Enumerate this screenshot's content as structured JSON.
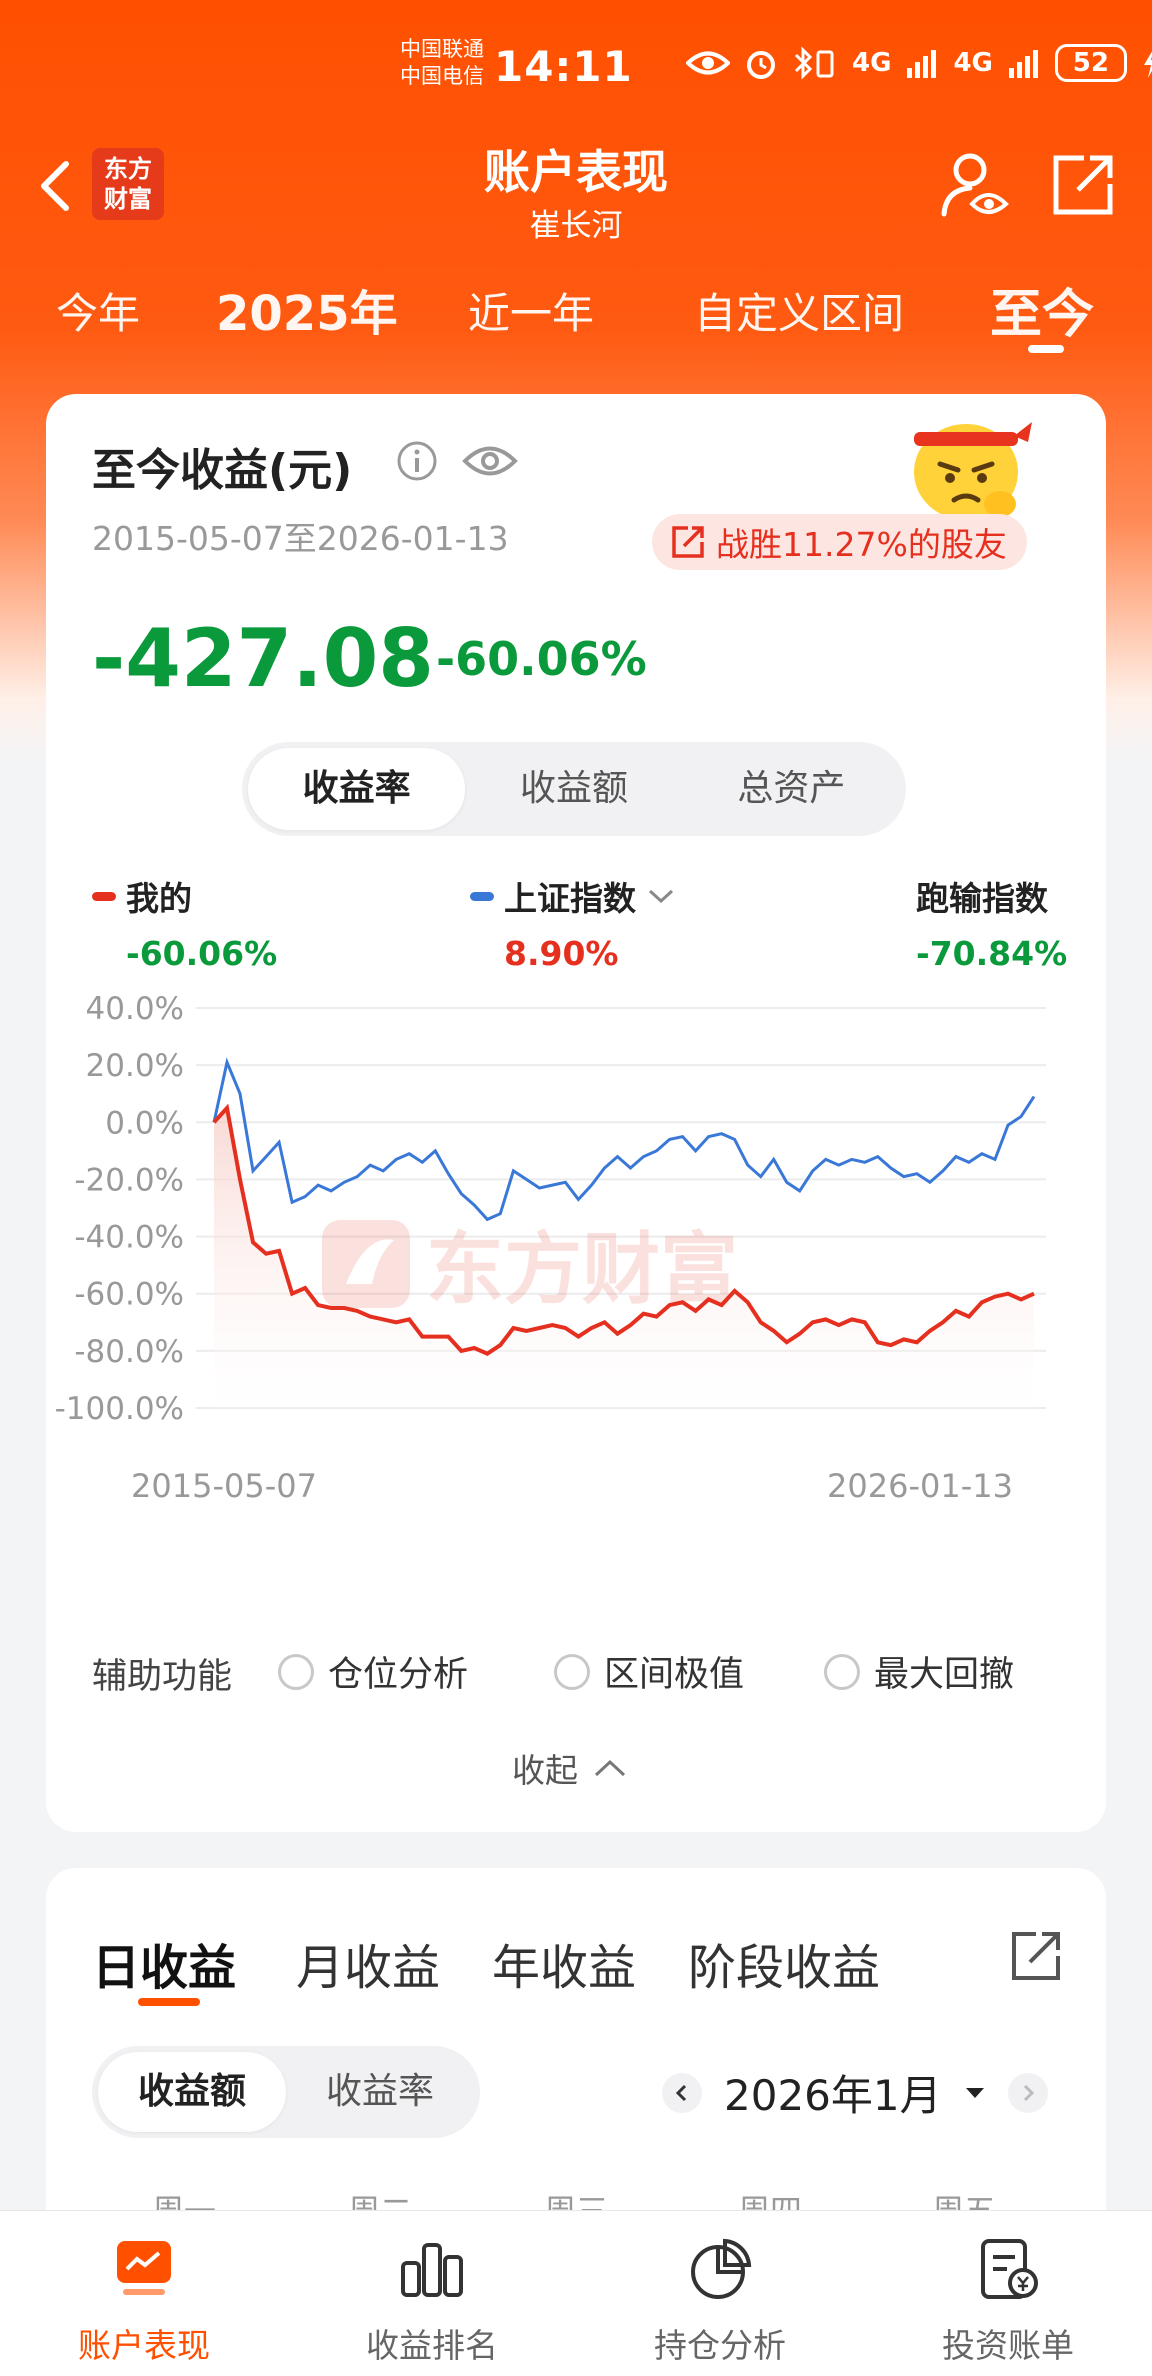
{
  "status_bar": {
    "carrier_1": "中国联通",
    "carrier_2": "中国电信",
    "time": "14:11",
    "network_1": "4G",
    "network_2": "4G",
    "battery": "52"
  },
  "header": {
    "logo_line1": "东方",
    "logo_line2": "财富",
    "title": "账户表现",
    "subtitle": "崔长河"
  },
  "period_tabs": [
    {
      "label": "今年"
    },
    {
      "label": "2025年"
    },
    {
      "label": "近一年"
    },
    {
      "label": "自定义区间"
    },
    {
      "label": "至今",
      "active": true
    }
  ],
  "summary": {
    "title": "至今收益(元)",
    "date_range": "2015-05-07至2026-01-13",
    "beat_text": "战胜11.27%的股友",
    "profit": "-427.08",
    "rate": "-60.06%",
    "segments": [
      "收益率",
      "收益额",
      "总资产"
    ],
    "active_segment": "收益率"
  },
  "legend": {
    "mine_label": "我的",
    "mine_value": "-60.06%",
    "index_label": "上证指数",
    "index_value": "8.90%",
    "lag_label": "跑输指数",
    "lag_value": "-70.84%"
  },
  "colors": {
    "brand_orange": "#ff5000",
    "mine_line": "#e5301f",
    "index_line": "#3a78d8",
    "positive_red": "#e5301f",
    "negative_green": "#0b9a3b"
  },
  "chart_data": {
    "type": "line",
    "x_start_label": "2015-05-07",
    "x_end_label": "2026-01-13",
    "y_ticks": [
      "40.0%",
      "20.0%",
      "0.0%",
      "-20.0%",
      "-40.0%",
      "-60.0%",
      "-80.0%",
      "-100.0%"
    ],
    "ylim": [
      -100,
      40
    ],
    "watermark": "东方财富",
    "series": [
      {
        "name": "我的",
        "color": "#e5301f",
        "values": [
          0,
          5,
          -20,
          -42,
          -46,
          -45,
          -60,
          -58,
          -64,
          -65,
          -65,
          -66,
          -68,
          -69,
          -70,
          -69,
          -75,
          -75,
          -75,
          -80,
          -79,
          -81,
          -78,
          -72,
          -73,
          -72,
          -71,
          -72,
          -75,
          -72,
          -70,
          -74,
          -71,
          -67,
          -68,
          -64,
          -63,
          -66,
          -62,
          -64,
          -59,
          -63,
          -70,
          -73,
          -77,
          -74,
          -70,
          -69,
          -71,
          -69,
          -70,
          -77,
          -78,
          -76,
          -77,
          -73,
          -70,
          -66,
          -68,
          -63,
          -61,
          -60,
          -62,
          -60
        ]
      },
      {
        "name": "上证指数",
        "color": "#3a78d8",
        "values": [
          0,
          21,
          10,
          -17,
          -12,
          -7,
          -28,
          -26,
          -22,
          -24,
          -21,
          -19,
          -15,
          -17,
          -13,
          -11,
          -14,
          -10,
          -18,
          -25,
          -29,
          -34,
          -32,
          -17,
          -20,
          -23,
          -22,
          -21,
          -27,
          -22,
          -16,
          -12,
          -16,
          -12,
          -10,
          -6,
          -5,
          -10,
          -5,
          -4,
          -6,
          -15,
          -19,
          -13,
          -21,
          -24,
          -17,
          -13,
          -15,
          -13,
          -14,
          -12,
          -16,
          -19,
          -18,
          -21,
          -17,
          -12,
          -14,
          -11,
          -13,
          -1,
          2,
          9
        ]
      }
    ]
  },
  "aux": {
    "label": "辅助功能",
    "options": [
      "仓位分析",
      "区间极值",
      "最大回撤"
    ],
    "collapse": "收起"
  },
  "revenue": {
    "tabs": [
      "日收益",
      "月收益",
      "年收益",
      "阶段收益"
    ],
    "active_tab": "日收益",
    "segments": [
      "收益额",
      "收益率"
    ],
    "month": "2026年1月",
    "weekdays": [
      "周一",
      "周二",
      "周三",
      "周四",
      "周五"
    ]
  },
  "bottom_nav": [
    {
      "label": "账户表现",
      "icon": "account-performance-icon",
      "active": true
    },
    {
      "label": "收益排名",
      "icon": "ranking-icon"
    },
    {
      "label": "持仓分析",
      "icon": "pie-chart-icon"
    },
    {
      "label": "投资账单",
      "icon": "bill-icon"
    }
  ]
}
